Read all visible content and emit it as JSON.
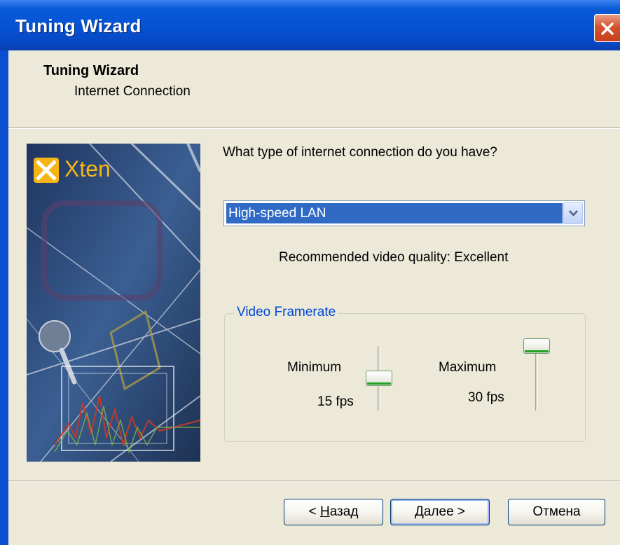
{
  "window": {
    "title": "Tuning Wizard"
  },
  "header": {
    "title": "Tuning Wizard",
    "subtitle": "Internet Connection"
  },
  "banner": {
    "logo_text": "Xten"
  },
  "question": "What type of internet connection do you have?",
  "connection_select": {
    "value": "High-speed LAN"
  },
  "recommendation": "Recommended video quality: Excellent",
  "framerate": {
    "group_label": "Video Framerate",
    "minimum": {
      "label": "Minimum",
      "value_text": "15 fps",
      "level": 0.5
    },
    "maximum": {
      "label": "Maximum",
      "value_text": "30 fps",
      "level": 1.0
    }
  },
  "buttons": {
    "back": {
      "prefix": "< ",
      "mnemonic": "Н",
      "rest": "азад"
    },
    "next": {
      "mnemonic": "Д",
      "rest": "алее",
      "suffix": " >"
    },
    "cancel": "Отмена"
  },
  "colors": {
    "title_bar": "#0552d4",
    "selection": "#316ac5",
    "group_label": "#0046d5",
    "slider_accent": "#21a121"
  }
}
